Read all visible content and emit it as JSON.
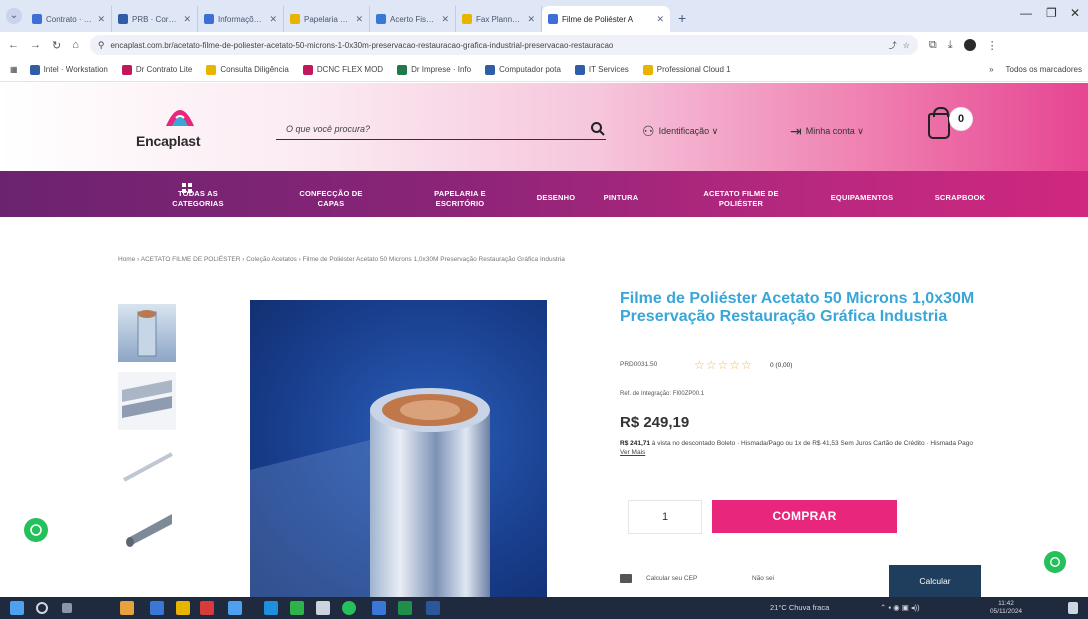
{
  "browser": {
    "tabs": [
      {
        "label": "Contrato · Shadow",
        "color": "#3d6fd6"
      },
      {
        "label": "PRB · Corena de",
        "color": "#2f5da8"
      },
      {
        "label": "Informações (B)",
        "color": "#3d6fd6"
      },
      {
        "label": "Papelaria Stencal",
        "color": "#e8b400"
      },
      {
        "label": "Acerto Fisca Pro",
        "color": "#3a78d8"
      },
      {
        "label": "Fax Planner Som",
        "color": "#e8b400"
      },
      {
        "label": "Filme de Poliéster A",
        "color": "#3d6fd6",
        "active": true
      }
    ],
    "new_tab": "+",
    "url": "encaplast.com.br/acetato-filme-de-poliester-acetato-50-microns-1-0x30m-preservacao-restauracao-grafica-industrial-preservacao-restauracao",
    "bookmarks": [
      {
        "label": "Intel · Workstation",
        "color": "#2f5da8"
      },
      {
        "label": "Dr Contrato Lite",
        "color": "#c2185b"
      },
      {
        "label": "Consulta Diligência",
        "color": "#e8b400"
      },
      {
        "label": "DCNC FLEX MOD",
        "color": "#c2185b"
      },
      {
        "label": "Dr Imprese · Info",
        "color": "#1f7a4a"
      },
      {
        "label": "Computador pota",
        "color": "#2f5da8"
      },
      {
        "label": "IT Services",
        "color": "#2f5da8"
      },
      {
        "label": "Professional Cloud 1",
        "color": "#e8b400"
      }
    ],
    "bookmarks_right": "Todos os marcadores"
  },
  "site": {
    "logo": "Encaplast",
    "search_placeholder": "O que você procura?",
    "login_label": "Identificação ∨",
    "account_label": "Minha conta ∨",
    "cart_count": "0",
    "nav": [
      {
        "label": "TODAS AS\nCATEGORIAS"
      },
      {
        "label": "CONFECÇÃO DE\nCAPAS"
      },
      {
        "label": "PAPELARIA E\nESCRITÓRIO"
      },
      {
        "label": "DESENHO"
      },
      {
        "label": "PINTURA"
      },
      {
        "label": "ACETATO FILME DE\nPOLIÉSTER"
      },
      {
        "label": "EQUIPAMENTOS"
      },
      {
        "label": "SCRAPBOOK"
      }
    ],
    "breadcrumb": "Home  ›  ACETATO FILME DE POLIÉSTER  ›  Coleção Acetatos  ›  Filme de Poliéster Acetato 50 Microns 1,0x30M Preservação Restauração Gráfica Industria"
  },
  "product": {
    "title": "Filme de Poliéster Acetato 50 Microns 1,0x30M Preservação Restauração Gráfica Industria",
    "sku": "PRD0031.50",
    "rating_value": 0,
    "rating_max": 5,
    "reviews": "0 (0,00)",
    "ref": "Ref. de Integração: FI00ZP00.1",
    "price": "R$ 249,19",
    "installment_strong": "R$ 241,71",
    "installment_rest": " à vista no descontado Boleto · Hismada/Pago ou 1x de R$ 41,53 Sem Juros Cartão de Crédito · Hismada Pago",
    "installment_more": "Ver Mais",
    "quantity": "1",
    "buy_label": "COMPRAR",
    "shipping_label": "Calcular seu CEP",
    "shipping_hint": "Não sei",
    "calc_label": "Calcular"
  },
  "taskbar": {
    "weather": "21°C  Chuva fraca",
    "time": "11:42",
    "date": "05/11/2024"
  }
}
